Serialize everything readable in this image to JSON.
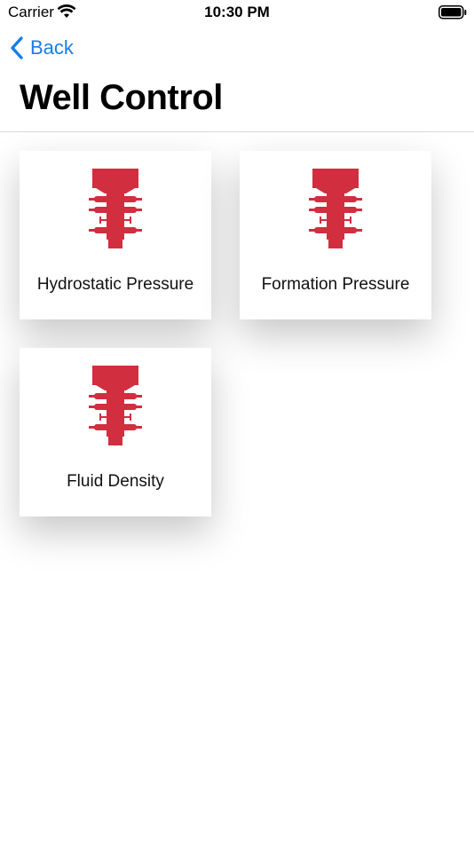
{
  "status_bar": {
    "carrier": "Carrier",
    "time": "10:30 PM",
    "wifi_icon": "wifi-icon",
    "battery_icon": "battery-full-icon"
  },
  "nav": {
    "back_label": "Back",
    "title": "Well Control"
  },
  "colors": {
    "accent": "#1a7ce8",
    "icon_red": "#d12e3f"
  },
  "cards": [
    {
      "label": "Hydrostatic Pressure",
      "icon": "blowout-preventer-icon"
    },
    {
      "label": "Formation Pressure",
      "icon": "blowout-preventer-icon"
    },
    {
      "label": "Fluid Density",
      "icon": "blowout-preventer-icon"
    }
  ]
}
